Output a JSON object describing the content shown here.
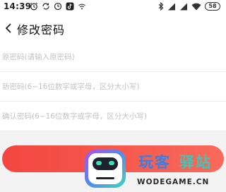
{
  "status_bar": {
    "time": "14:39",
    "battery_level": "58",
    "left_icons": [
      "alarm-icon",
      "sync-icon",
      "clock-icon",
      "tiktok-icon",
      "wifi-bars-icon",
      "signal-icon"
    ],
    "right_icons": [
      "bluetooth-icon",
      "signal-icon",
      "signal-icon",
      "wifi-icon",
      "battery-icon"
    ]
  },
  "header": {
    "back_icon": "chevron-left-icon",
    "title": "修改密码"
  },
  "form": {
    "old_password_placeholder": "原密码(请输入原密码)",
    "new_password_placeholder": "新密码(6~16位数字或字母，区分大小写)",
    "confirm_password_placeholder": "确认密码(6~16位数字或字母，区分大小写)"
  },
  "submit": {
    "label": "提交"
  },
  "watermark": {
    "brand_part1": "玩客",
    "brand_part2": "驿站",
    "domain": "WODEGAME.CN"
  },
  "colors": {
    "accent_start": "#f2463f",
    "accent_end": "#f96a5a",
    "background": "#f3f3f3"
  }
}
